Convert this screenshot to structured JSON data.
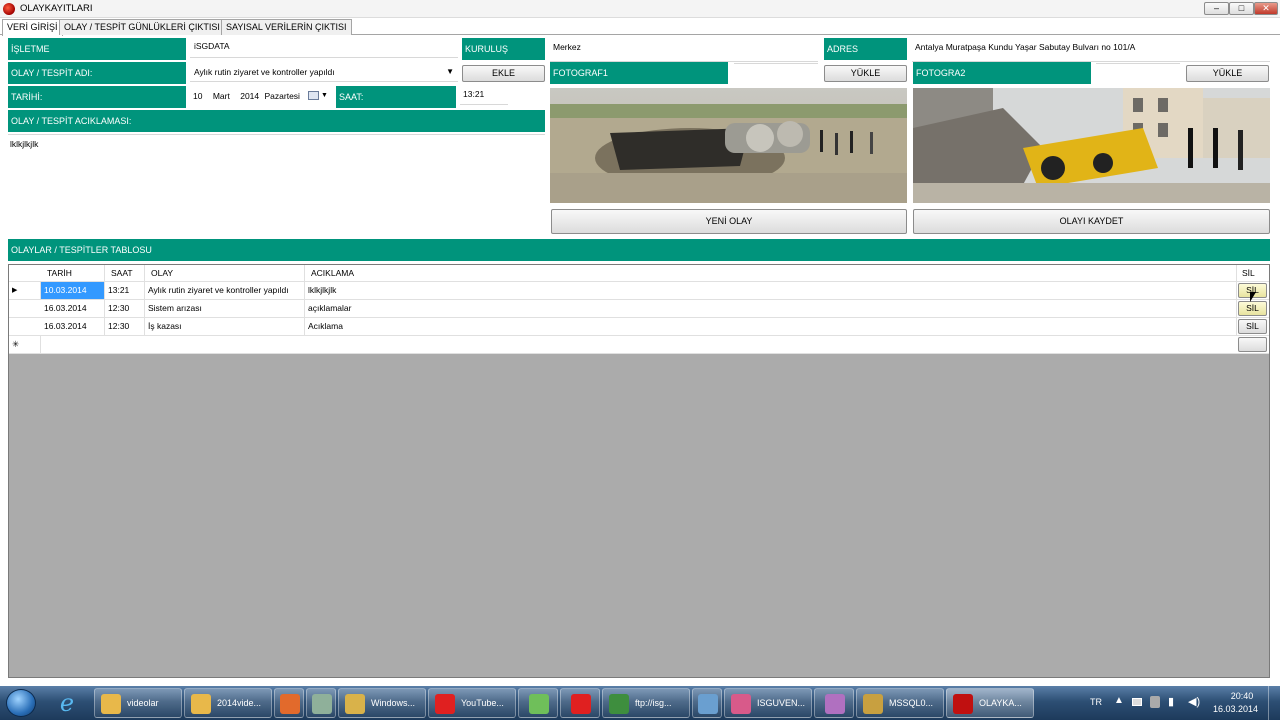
{
  "window": {
    "title": "OLAYKAYITLARI",
    "min": "–",
    "max": "□",
    "close": "✕"
  },
  "tabs": [
    {
      "label": "VERİ GİRİŞİ"
    },
    {
      "label": "OLAY / TESPİT GÜNLÜKLERİ ÇIKTISI"
    },
    {
      "label": "SAYISAL VERİLERİN ÇIKTISI"
    }
  ],
  "form": {
    "isletme_label": "İŞLETME",
    "isletme_value": "iSGDATA",
    "kurulus_label": "KURULUŞ",
    "kurulus_value": "Merkez",
    "adres_label": "ADRES",
    "adres_value": "Antalya Muratpaşa Kundu Yaşar Sabutay Bulvarı no 101/A",
    "olay_adi_label": "OLAY / TESPİT ADI:",
    "olay_adi_value": "Aylık rutin ziyaret ve kontroller yapıldı",
    "ekle_label": "EKLE",
    "tarih_label": "TARİHİ:",
    "tarih_day": "10",
    "tarih_month": "Mart",
    "tarih_year": "2014",
    "tarih_weekday": "Pazartesi",
    "saat_label": "SAAT:",
    "saat_value": "13:21",
    "aciklama_label": "OLAY / TESPİT ACIKLAMASI:",
    "aciklama_value": "lklkjlkjlk",
    "foto1_label": "FOTOGRAF1",
    "foto2_label": "FOTOGRA2",
    "yukle_label": "YÜKLE",
    "yeni_olay_label": "YENİ OLAY",
    "kaydet_label": "OLAYI KAYDET"
  },
  "table": {
    "title": "OLAYLAR / TESPİTLER TABLOSU",
    "columns": [
      "TARİH",
      "SAAT",
      "OLAY",
      "ACIKLAMA",
      "SİL"
    ],
    "rows": [
      {
        "tarih": "10.03.2014",
        "saat": "13:21",
        "olay": "Aylık rutin ziyaret ve kontroller yapıldı",
        "aciklama": "lklkjlkjlk",
        "sil": "SİL",
        "marker": "▶"
      },
      {
        "tarih": "16.03.2014",
        "saat": "12:30",
        "olay": "Sistem arızası",
        "aciklama": "açıklamalar",
        "sil": "SİL",
        "marker": ""
      },
      {
        "tarih": "16.03.2014",
        "saat": "12:30",
        "olay": "İş kazası",
        "aciklama": "Acıklama",
        "sil": "SİL",
        "marker": ""
      }
    ],
    "new_row_marker": "✳"
  },
  "taskbar": {
    "items": [
      {
        "label": "videolar",
        "color": "#e8b84a"
      },
      {
        "label": "2014vide...",
        "color": "#e8b84a"
      },
      {
        "label": "",
        "color": "#e26a2c"
      },
      {
        "label": "",
        "color": "#8fb09a"
      },
      {
        "label": "Windows...",
        "color": "#d9b24a"
      },
      {
        "label": "YouTube...",
        "color": "#e02020"
      },
      {
        "label": "",
        "color": "#6fbf5a"
      },
      {
        "label": "",
        "color": "#e02020"
      },
      {
        "label": "ftp://isg...",
        "color": "#3e8e3e"
      },
      {
        "label": "",
        "color": "#6a9fd0"
      },
      {
        "label": "ISGUVEN...",
        "color": "#d85a8a"
      },
      {
        "label": "",
        "color": "#b070c0"
      },
      {
        "label": "MSSQL0...",
        "color": "#c8a040"
      },
      {
        "label": "OLAYKA...",
        "color": "#c01010"
      }
    ],
    "lang": "TR",
    "time": "20:40",
    "date": "16.03.2014"
  }
}
